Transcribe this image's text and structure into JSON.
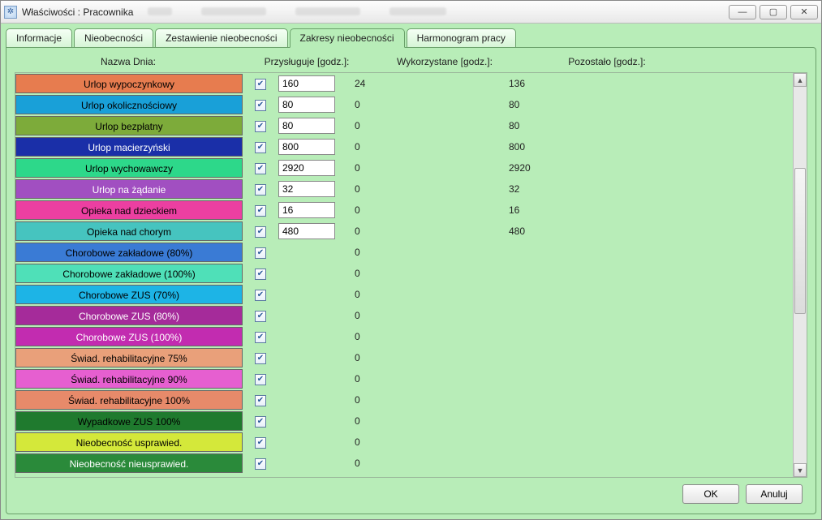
{
  "window": {
    "title": "Właściwości : Pracownika"
  },
  "tabs": [
    {
      "label": "Informacje"
    },
    {
      "label": "Nieobecności"
    },
    {
      "label": "Zestawienie nieobecności"
    },
    {
      "label": "Zakresy nieobecności",
      "active": true
    },
    {
      "label": "Harmonogram pracy"
    }
  ],
  "columns": {
    "name": "Nazwa Dnia:",
    "entitled": "Przysługuje [godz.]:",
    "used": "Wykorzystane [godz.]:",
    "left": "Pozostało [godz.]:"
  },
  "rows": [
    {
      "label": "Urlop wypoczynkowy",
      "color": "#e77c4f",
      "text": "#000",
      "checked": true,
      "entitled": "160",
      "used": "24",
      "left": "136"
    },
    {
      "label": "Urlop okolicznościowy",
      "color": "#19a0d8",
      "text": "#000",
      "checked": true,
      "entitled": "80",
      "used": "0",
      "left": "80"
    },
    {
      "label": "Urlop bezpłatny",
      "color": "#7dab3a",
      "text": "#000",
      "checked": true,
      "entitled": "80",
      "used": "0",
      "left": "80"
    },
    {
      "label": "Urlop macierzyński",
      "color": "#1a2fa8",
      "text": "#fff",
      "checked": true,
      "entitled": "800",
      "used": "0",
      "left": "800"
    },
    {
      "label": "Urlop wychowawczy",
      "color": "#2dd88a",
      "text": "#000",
      "checked": true,
      "entitled": "2920",
      "used": "0",
      "left": "2920"
    },
    {
      "label": "Urlop na żądanie",
      "color": "#a14fc1",
      "text": "#fff",
      "checked": true,
      "entitled": "32",
      "used": "0",
      "left": "32"
    },
    {
      "label": "Opieka nad dzieckiem",
      "color": "#ec3fa1",
      "text": "#000",
      "checked": true,
      "entitled": "16",
      "used": "0",
      "left": "16"
    },
    {
      "label": "Opieka nad chorym",
      "color": "#46c4bf",
      "text": "#000",
      "checked": true,
      "entitled": "480",
      "used": "0",
      "left": "480"
    },
    {
      "label": "Chorobowe zakładowe (80%)",
      "color": "#3a7bd5",
      "text": "#000",
      "checked": true,
      "entitled": "",
      "used": "0",
      "left": ""
    },
    {
      "label": "Chorobowe zakładowe (100%)",
      "color": "#4fe0b8",
      "text": "#000",
      "checked": true,
      "entitled": "",
      "used": "0",
      "left": ""
    },
    {
      "label": "Chorobowe ZUS (70%)",
      "color": "#1db4e6",
      "text": "#000",
      "checked": true,
      "entitled": "",
      "used": "0",
      "left": ""
    },
    {
      "label": "Chorobowe ZUS (80%)",
      "color": "#a52b9a",
      "text": "#fff",
      "checked": true,
      "entitled": "",
      "used": "0",
      "left": ""
    },
    {
      "label": "Chorobowe ZUS (100%)",
      "color": "#c22cb0",
      "text": "#fff",
      "checked": true,
      "entitled": "",
      "used": "0",
      "left": ""
    },
    {
      "label": "Świad. rehabilitacyjne 75%",
      "color": "#e9a07a",
      "text": "#000",
      "checked": true,
      "entitled": "",
      "used": "0",
      "left": ""
    },
    {
      "label": "Świad. rehabilitacyjne 90%",
      "color": "#e65fd0",
      "text": "#000",
      "checked": true,
      "entitled": "",
      "used": "0",
      "left": ""
    },
    {
      "label": "Świad. rehabilitacyjne 100%",
      "color": "#e78a6a",
      "text": "#000",
      "checked": true,
      "entitled": "",
      "used": "0",
      "left": ""
    },
    {
      "label": "Wypadkowe ZUS 100%",
      "color": "#1f7a2e",
      "text": "#000",
      "checked": true,
      "entitled": "",
      "used": "0",
      "left": ""
    },
    {
      "label": "Nieobecność usprawied.",
      "color": "#d4e83a",
      "text": "#000",
      "checked": true,
      "entitled": "",
      "used": "0",
      "left": ""
    },
    {
      "label": "Nieobecność nieusprawied.",
      "color": "#2a8a3a",
      "text": "#fff",
      "checked": true,
      "entitled": "",
      "used": "0",
      "left": ""
    }
  ],
  "buttons": {
    "ok": "OK",
    "cancel": "Anuluj"
  },
  "wincontrols": {
    "min": "—",
    "max": "▢",
    "close": "✕"
  }
}
